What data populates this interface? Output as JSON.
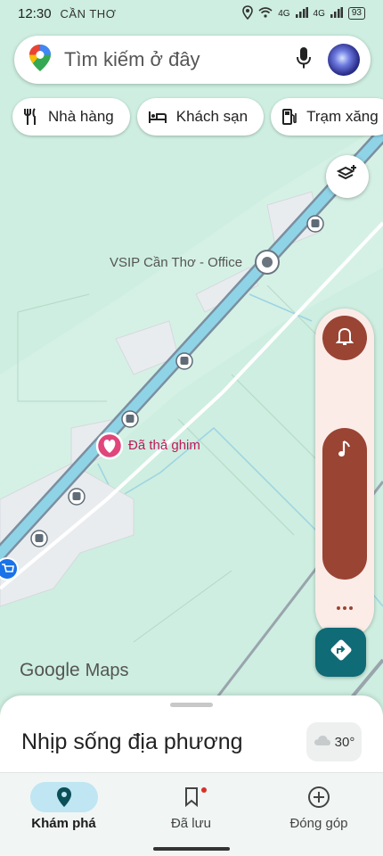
{
  "status_bar": {
    "time": "12:30",
    "place": "CẦN THƠ",
    "network_1": "4G",
    "network_2": "4G",
    "battery": "93"
  },
  "search": {
    "placeholder": "Tìm kiếm ở đây",
    "leading_icon": "google-maps-pin-icon",
    "mic_icon": "microphone-icon"
  },
  "chips": [
    {
      "label": "Nhà hàng",
      "icon": "fork-knife-icon"
    },
    {
      "label": "Khách sạn",
      "icon": "bed-icon"
    },
    {
      "label": "Trạm xăng",
      "icon": "gas-station-icon"
    }
  ],
  "map": {
    "poi_vsip": "VSIP Cần Thơ - Office",
    "pin_label": "Đã thả ghim",
    "logo_google": "Google",
    "logo_maps": "Maps"
  },
  "sheet": {
    "title": "Nhịp sống địa phương",
    "weather": "30°",
    "weather_icon": "cloud-icon"
  },
  "nav": [
    {
      "label": "Khám phá",
      "icon": "location-pin-icon",
      "active": true
    },
    {
      "label": "Đã lưu",
      "icon": "bookmark-icon",
      "active": false
    },
    {
      "label": "Đóng góp",
      "icon": "plus-circle-icon",
      "active": false
    }
  ],
  "colors": {
    "map_background": "#cdeee0",
    "road": "#8fd3e6",
    "accent_brown": "#9a4434",
    "directions_teal": "#0f6b76",
    "pin_pink": "#e0457b"
  }
}
